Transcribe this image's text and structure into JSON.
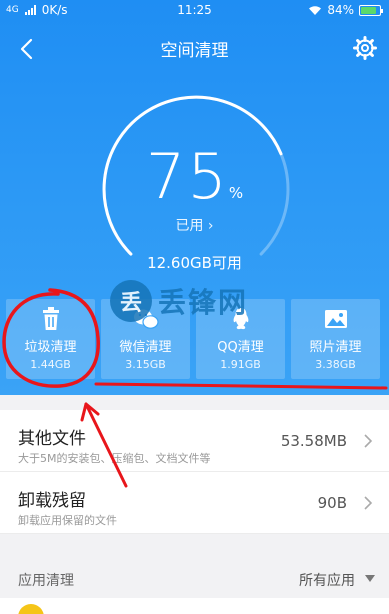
{
  "status_bar": {
    "network": "4G",
    "speed": "0K/s",
    "time": "11:25",
    "battery": "84%",
    "battery_level": 0.84
  },
  "nav": {
    "title": "空间清理",
    "back_icon": "back-arrow-icon",
    "settings_icon": "gear-icon"
  },
  "storage": {
    "percent": "75",
    "percent_sign": "%",
    "used_label": "已用 ›",
    "available": "12.60GB可用",
    "used_fraction": 0.75
  },
  "categories": [
    {
      "label": "垃圾清理",
      "size": "1.44GB",
      "icon": "trash-icon"
    },
    {
      "label": "微信清理",
      "size": "3.15GB",
      "icon": "wechat-icon"
    },
    {
      "label": "QQ清理",
      "size": "1.91GB",
      "icon": "qq-icon"
    },
    {
      "label": "照片清理",
      "size": "3.38GB",
      "icon": "photo-icon"
    }
  ],
  "watermark": {
    "char": "丢",
    "text": "丢锋网"
  },
  "list": [
    {
      "title": "其他文件",
      "desc": "大于5M的安装包、压缩包、文档文件等",
      "value": "53.58MB"
    },
    {
      "title": "卸载残留",
      "desc": "卸载应用保留的文件",
      "value": "90B"
    }
  ],
  "app_section": {
    "title": "应用清理",
    "filter": "所有应用"
  },
  "colors": {
    "header_blue": "#2b98f5",
    "annotation_red": "#e8161b",
    "app_icon_yellow": "#f5c518"
  }
}
